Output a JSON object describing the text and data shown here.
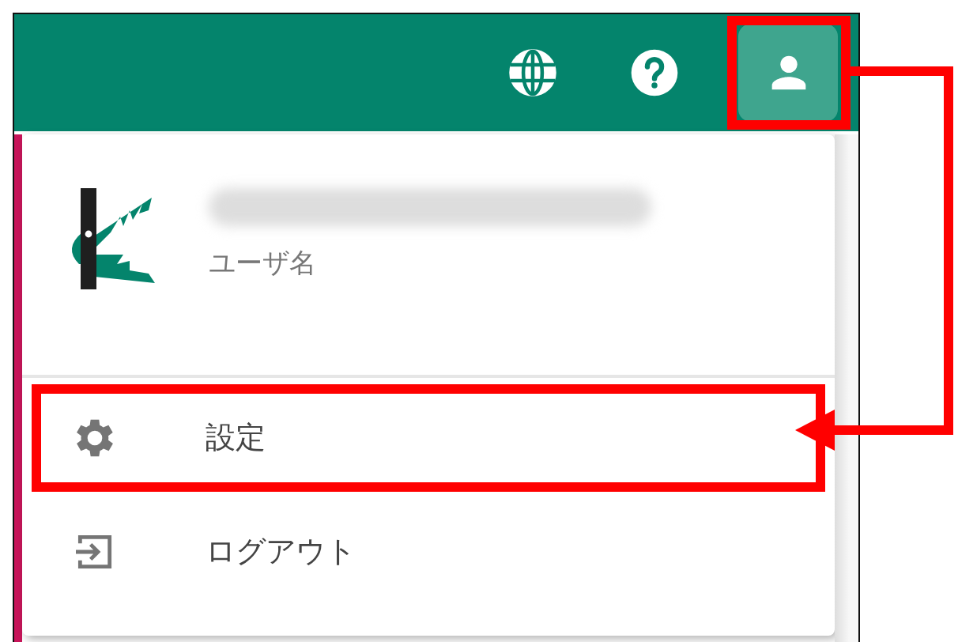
{
  "header": {
    "avatar_button": {
      "highlighted": true
    }
  },
  "menu": {
    "user_label": "ユーザ名",
    "items": [
      {
        "kind": "settings",
        "label": "設定",
        "highlighted": true
      },
      {
        "kind": "logout",
        "label": "ログアウト",
        "highlighted": false
      }
    ]
  }
}
